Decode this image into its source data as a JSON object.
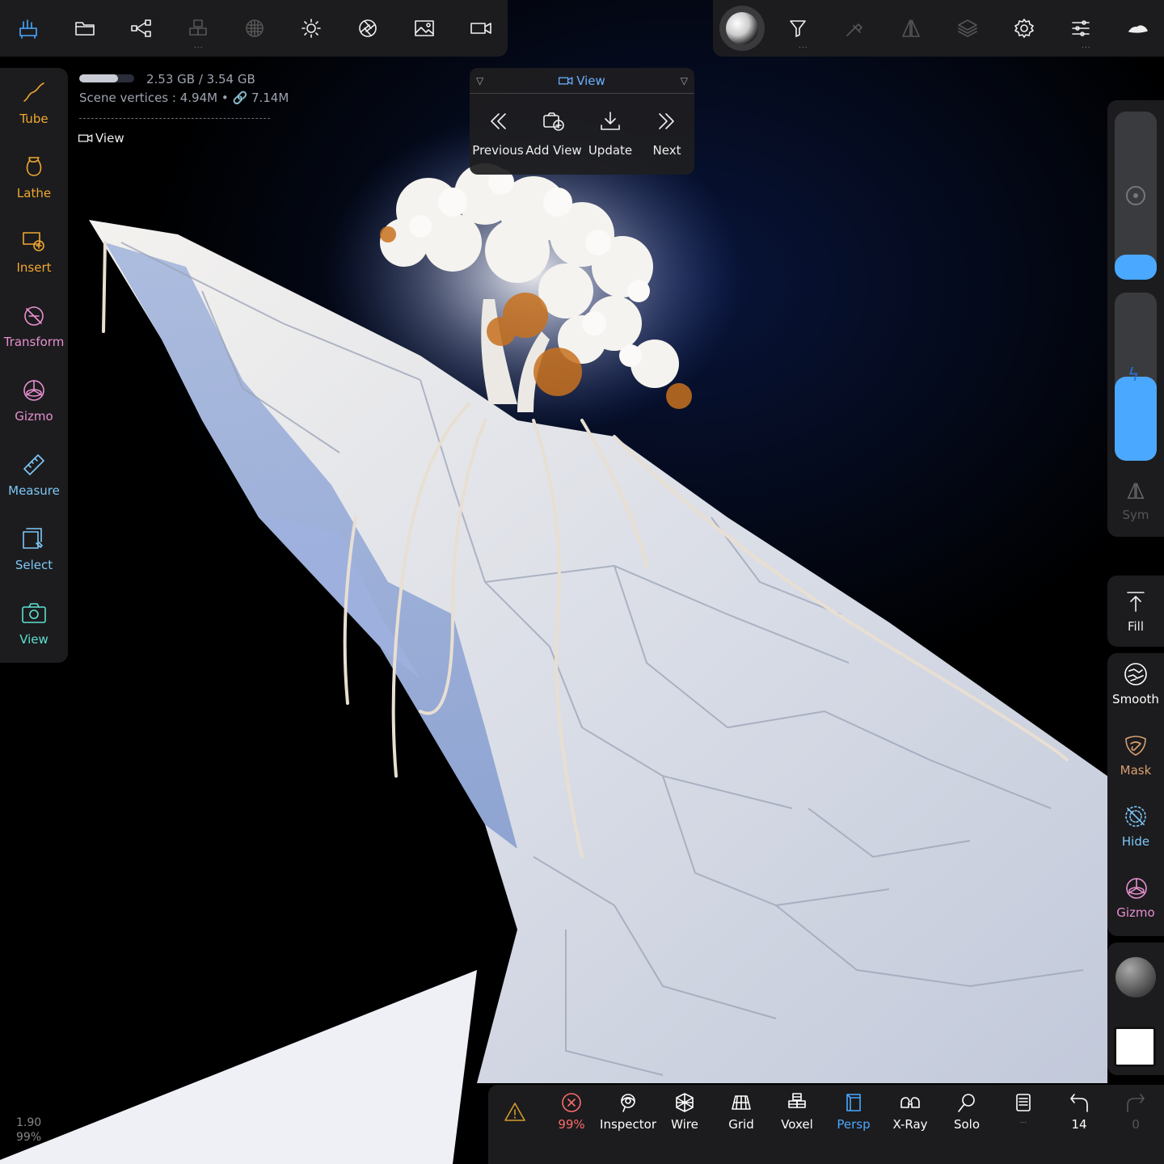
{
  "top_left_toolbar": {
    "icons": [
      "toolbox-icon",
      "folder-icon",
      "scene-tree-icon",
      "voxel-cubes-icon",
      "texture-sphere-icon",
      "light-icon",
      "camera-aperture-icon",
      "image-icon",
      "video-camera-icon"
    ]
  },
  "top_right_toolbar": {
    "icons": [
      "matcap-icon",
      "filter-icon",
      "eyedropper-icon",
      "symmetry-icon",
      "layers-icon",
      "settings-gear-icon",
      "sliders-icon",
      "cloud-icon"
    ]
  },
  "stats": {
    "memory": "2.53 GB / 3.54 GB",
    "memory_fraction": 0.71,
    "vertices_label": "Scene vertices :",
    "vertices_value": "4.94M",
    "separator": "•",
    "linked_value": "7.14M",
    "view_label": "View"
  },
  "left_tools": [
    {
      "label": "Tube",
      "color": "#f0a830",
      "icon": "tube-icon"
    },
    {
      "label": "Lathe",
      "color": "#f0a830",
      "icon": "lathe-icon"
    },
    {
      "label": "Insert",
      "color": "#f0a830",
      "icon": "insert-icon"
    },
    {
      "label": "Transform",
      "color": "#e890d0",
      "icon": "transform-icon"
    },
    {
      "label": "Gizmo",
      "color": "#e890d0",
      "icon": "gizmo-icon"
    },
    {
      "label": "Measure",
      "color": "#7ec8f8",
      "icon": "ruler-icon"
    },
    {
      "label": "Select",
      "color": "#7ec8f8",
      "icon": "select-icon"
    },
    {
      "label": "View",
      "color": "#5ee0d0",
      "icon": "camera-icon"
    }
  ],
  "view_popup": {
    "title": "View",
    "buttons": [
      {
        "label": "Previous",
        "icon": "previous-icon"
      },
      {
        "label": "Add View",
        "icon": "add-view-icon"
      },
      {
        "label": "Update",
        "icon": "update-icon"
      },
      {
        "label": "Next",
        "icon": "next-icon"
      }
    ]
  },
  "right_slider": {
    "radius_fraction": 0.15,
    "intensity_fraction": 0.5,
    "sym_label": "Sym"
  },
  "right_tools": {
    "fill_label": "Fill",
    "items": [
      {
        "label": "Smooth",
        "color": "#ffffff",
        "icon": "smooth-icon"
      },
      {
        "label": "Mask",
        "color": "#d8a070",
        "icon": "mask-icon"
      },
      {
        "label": "Hide",
        "color": "#7ec8f8",
        "icon": "hide-icon"
      },
      {
        "label": "Gizmo",
        "color": "#e890d0",
        "icon": "gizmo-icon"
      }
    ]
  },
  "bottom_toolbar": {
    "warning_icon": "warning-icon",
    "items": [
      {
        "label": "99%",
        "color": "#ff6a6a",
        "icon": "close-circle-icon"
      },
      {
        "label": "Inspector",
        "color": "#ffffff",
        "icon": "inspector-icon"
      },
      {
        "label": "Wire",
        "color": "#ffffff",
        "icon": "wire-icon"
      },
      {
        "label": "Grid",
        "color": "#ffffff",
        "icon": "grid-icon"
      },
      {
        "label": "Voxel",
        "color": "#ffffff",
        "icon": "voxel-icon"
      },
      {
        "label": "Persp",
        "color": "#4aa8ff",
        "icon": "perspective-icon"
      },
      {
        "label": "X-Ray",
        "color": "#ffffff",
        "icon": "xray-icon"
      },
      {
        "label": "Solo",
        "color": "#ffffff",
        "icon": "solo-icon"
      },
      {
        "label": "",
        "color": "#ffffff",
        "icon": "history-icon"
      },
      {
        "label": "14",
        "color": "#ffffff",
        "icon": "undo-icon"
      },
      {
        "label": "0",
        "color": "#555555",
        "icon": "redo-icon"
      }
    ]
  },
  "bottom_left": {
    "version": "1.90",
    "percent": "99%"
  }
}
